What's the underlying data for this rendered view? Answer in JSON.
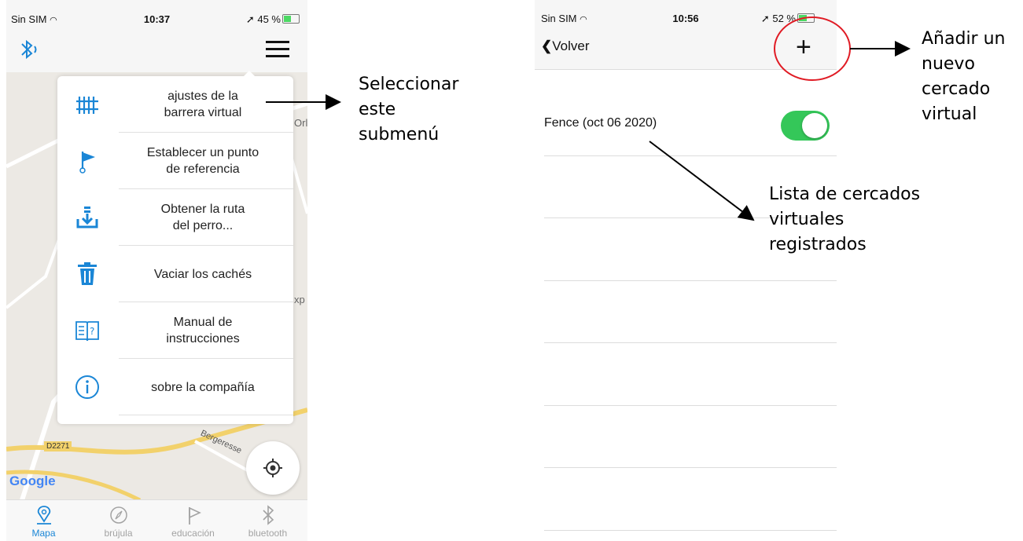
{
  "left_screen": {
    "status_bar": {
      "carrier": "Sin SIM",
      "time": "10:37",
      "battery": "45 %"
    },
    "map": {
      "road_label": "D2271",
      "street_label": "Bergeresse",
      "edge_label_1": "Orl",
      "edge_label_2": "xp",
      "attribution": "Google"
    },
    "menu": {
      "items": [
        {
          "label": "ajustes de la\nbarrera virtual",
          "icon": "fence-icon"
        },
        {
          "label": "Establecer un punto\nde referencia",
          "icon": "flag-pin-icon"
        },
        {
          "label": "Obtener la ruta\ndel perro...",
          "icon": "download-icon"
        },
        {
          "label": "Vaciar los cachés",
          "icon": "trash-icon"
        },
        {
          "label": "Manual de\ninstrucciones",
          "icon": "manual-book-icon"
        },
        {
          "label": "sobre la compañía",
          "icon": "info-icon"
        }
      ]
    },
    "tabs": [
      {
        "label": "Mapa",
        "icon": "map-pin-icon",
        "active": true
      },
      {
        "label": "brújula",
        "icon": "compass-icon",
        "active": false
      },
      {
        "label": "educación",
        "icon": "flag-icon",
        "active": false
      },
      {
        "label": "bluetooth",
        "icon": "bluetooth-icon",
        "active": false
      }
    ]
  },
  "right_screen": {
    "status_bar": {
      "carrier": "Sin SIM",
      "time": "10:56",
      "battery": "52 %"
    },
    "nav": {
      "back_label": "Volver",
      "add_label": "+"
    },
    "fence_list": [
      {
        "label": "Fence  (oct 06 2020)",
        "enabled": true
      }
    ]
  },
  "annotations": {
    "select_submenu": "Seleccionar\neste\nsubmenú",
    "add_fence": "Añadir un\nnuevo\ncercado\nvirtual",
    "fence_list": "Lista de cercados\nvirtuales\nregistrados"
  },
  "colors": {
    "accent": "#1a86d6",
    "toggle_on": "#34c759",
    "highlight_circle": "#e01b24"
  }
}
